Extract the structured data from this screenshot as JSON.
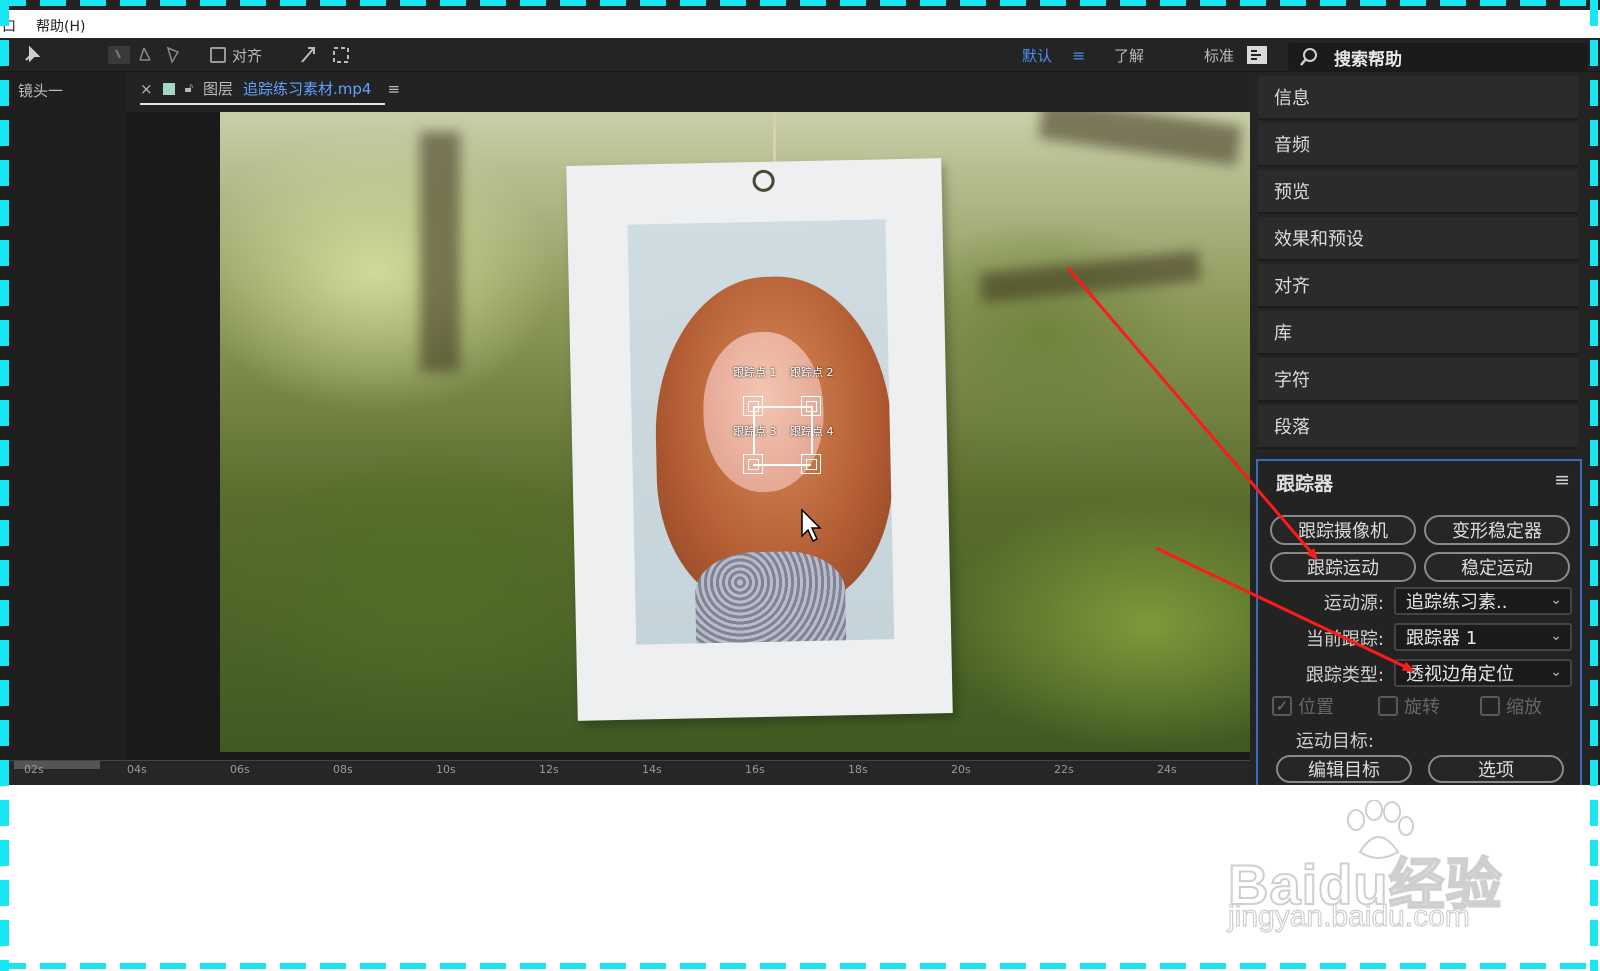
{
  "menubar": {
    "help_menu": "帮助(H)",
    "left_glyph": "口"
  },
  "toolbar": {
    "snap_label": "对齐",
    "workspace_default": "默认",
    "workspace_menu": "≡",
    "workspace_learn": "了解",
    "workspace_standard": "标准"
  },
  "search": {
    "placeholder": "搜索帮助"
  },
  "left_panel": {
    "title": "镜头一"
  },
  "viewer": {
    "tab_close": "×",
    "tab_prefix": "图层",
    "tab_filename": "追踪练习素材.mp4",
    "tab_menu": "≡",
    "track_points": [
      "跟踪点 1",
      "跟踪点 2",
      "跟踪点 3",
      "跟踪点 4"
    ]
  },
  "timeline": {
    "ticks": [
      "02s",
      "04s",
      "06s",
      "08s",
      "10s",
      "12s",
      "14s",
      "16s",
      "18s",
      "20s",
      "22s",
      "24s"
    ]
  },
  "right_panels": [
    "信息",
    "音频",
    "预览",
    "效果和预设",
    "对齐",
    "库",
    "字符",
    "段落"
  ],
  "tracker": {
    "title": "跟踪器",
    "menu": "≡",
    "buttons": {
      "track_camera": "跟踪摄像机",
      "warp_stabilizer": "变形稳定器",
      "track_motion": "跟踪运动",
      "stabilize_motion": "稳定运动"
    },
    "motion_source_label": "运动源:",
    "motion_source_value": "追踪练习素..",
    "current_track_label": "当前跟踪:",
    "current_track_value": "跟踪器 1",
    "track_type_label": "跟踪类型:",
    "track_type_value": "透视边角定位",
    "position_label": "位置",
    "rotation_label": "旋转",
    "scale_label": "缩放",
    "motion_target_label": "运动目标:",
    "edit_target": "编辑目标",
    "options": "选项"
  },
  "watermark": {
    "brand": "Bai",
    "brand2": "du",
    "brand_cn": "经验",
    "url": "jingyan.baidu.com"
  },
  "colors": {
    "accent": "#4a8df0",
    "arrow": "#ff1a1a",
    "frame_dash": "#18e6f0",
    "tracker_border": "#3a6db8"
  }
}
